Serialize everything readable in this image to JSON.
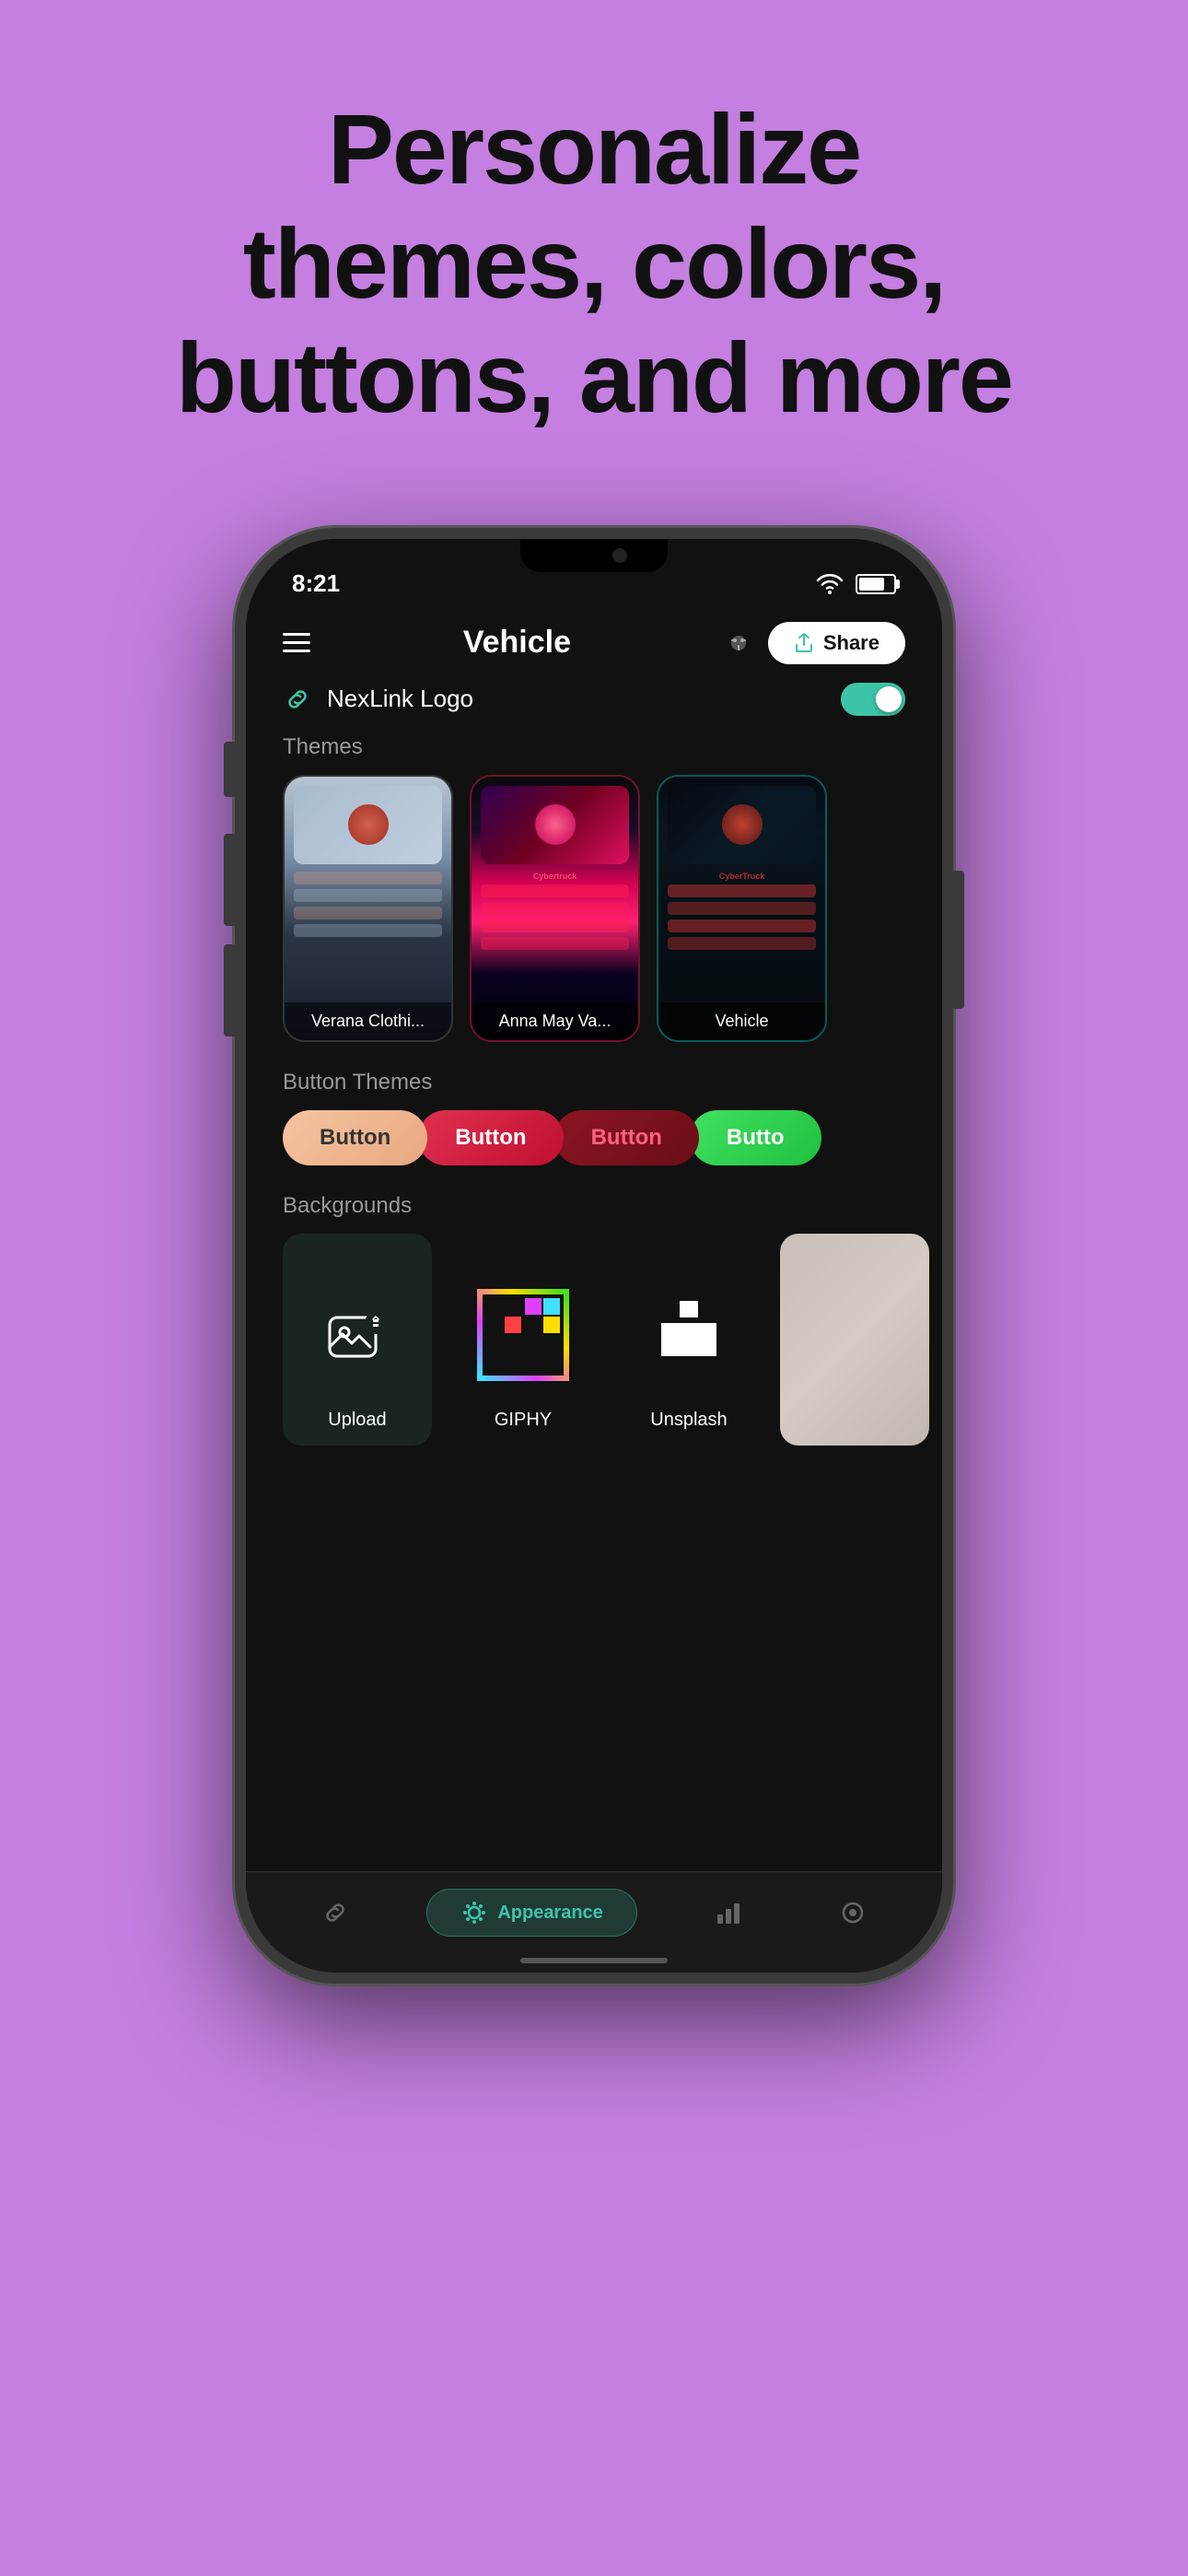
{
  "hero": {
    "line1": "Personalize",
    "line2": "themes, colors,",
    "line3": "buttons, and more"
  },
  "status": {
    "time": "8:21",
    "wifi": "wifi",
    "battery": "battery"
  },
  "nav": {
    "title": "Vehicle",
    "share_label": "Share"
  },
  "logo_row": {
    "text": "NexLink Logo"
  },
  "themes": {
    "section_label": "Themes",
    "items": [
      {
        "name": "Verana Clothi..."
      },
      {
        "name": "Anna May Va..."
      },
      {
        "name": "Vehicle"
      }
    ]
  },
  "button_themes": {
    "section_label": "Button Themes",
    "buttons": [
      {
        "label": "Button"
      },
      {
        "label": "Button"
      },
      {
        "label": "Button"
      },
      {
        "label": "Butto"
      }
    ]
  },
  "backgrounds": {
    "section_label": "Backgrounds",
    "items": [
      {
        "label": "Upload"
      },
      {
        "label": "GIPHY"
      },
      {
        "label": "Unsplash"
      },
      {
        "label": ""
      }
    ]
  },
  "tab_bar": {
    "tabs": [
      {
        "icon": "link",
        "label": "",
        "active": false
      },
      {
        "icon": "appearance",
        "label": "Appearance",
        "active": true
      },
      {
        "icon": "chart",
        "label": "",
        "active": false
      },
      {
        "icon": "eye",
        "label": "",
        "active": false
      }
    ],
    "active_tab": "Appearance"
  }
}
